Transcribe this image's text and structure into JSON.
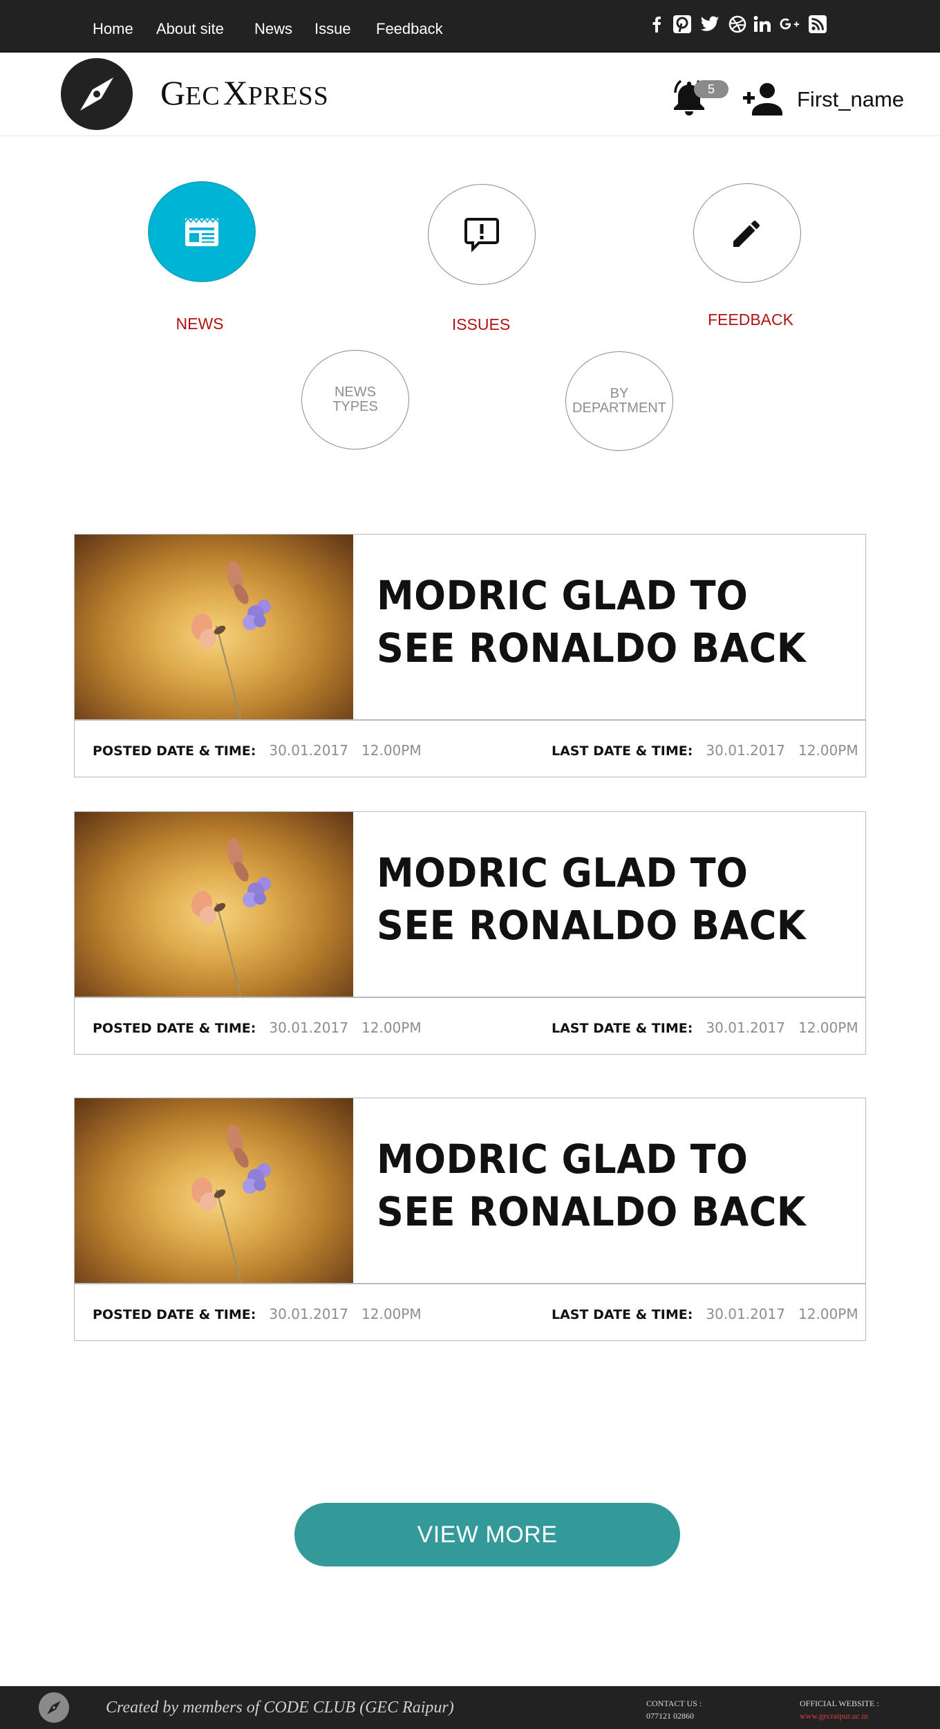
{
  "nav": {
    "links": [
      "Home",
      "About site",
      "News",
      "Issue",
      "Feedback"
    ],
    "social_icons": [
      "facebook-icon",
      "pinterest-icon",
      "twitter-icon",
      "dribbble-icon",
      "linkedin-icon",
      "google-plus-icon",
      "rss-icon"
    ]
  },
  "header": {
    "brand_g": "G",
    "brand_ec": "EC",
    "brand_x": "X",
    "brand_press": "PRESS",
    "notification_count": "5",
    "username": "First_name"
  },
  "categories": {
    "news": "NEWS",
    "issues": "ISSUES",
    "feedback": "FEEDBACK",
    "news_types_1": "NEWS",
    "news_types_2": "TYPES",
    "by_department_1": "BY",
    "by_department_2": "DEPARTMENT"
  },
  "colors": {
    "nav_bg": "#222222",
    "active_category": "#00b4d6",
    "category_label": "#b31212",
    "view_more": "#339a99"
  },
  "articles": [
    {
      "title": "MODRIC GLAD TO SEE RONALDO BACK",
      "posted_label": "POSTED DATE & TIME:",
      "posted_date": "30.01.2017",
      "posted_time": "12.00PM",
      "last_label": "LAST DATE & TIME:",
      "last_date": "30.01.2017",
      "last_time": "12.00PM"
    },
    {
      "title": "MODRIC GLAD TO SEE RONALDO BACK",
      "posted_label": "POSTED DATE & TIME:",
      "posted_date": "30.01.2017",
      "posted_time": "12.00PM",
      "last_label": "LAST DATE & TIME:",
      "last_date": "30.01.2017",
      "last_time": "12.00PM"
    },
    {
      "title": "MODRIC GLAD TO SEE RONALDO BACK",
      "posted_label": "POSTED DATE & TIME:",
      "posted_date": "30.01.2017",
      "posted_time": "12.00PM",
      "last_label": "LAST DATE & TIME:",
      "last_date": "30.01.2017",
      "last_time": "12.00PM"
    }
  ],
  "view_more_label": "VIEW MORE",
  "footer": {
    "created_by": "Created by members of CODE CLUB (GEC Raipur)",
    "contact_label": "CONTACT US :",
    "contact_value": "077121 02860",
    "website_label": "OFFICIAL WEBSITE :",
    "website_value": "www.gecraipur.ac.in"
  }
}
